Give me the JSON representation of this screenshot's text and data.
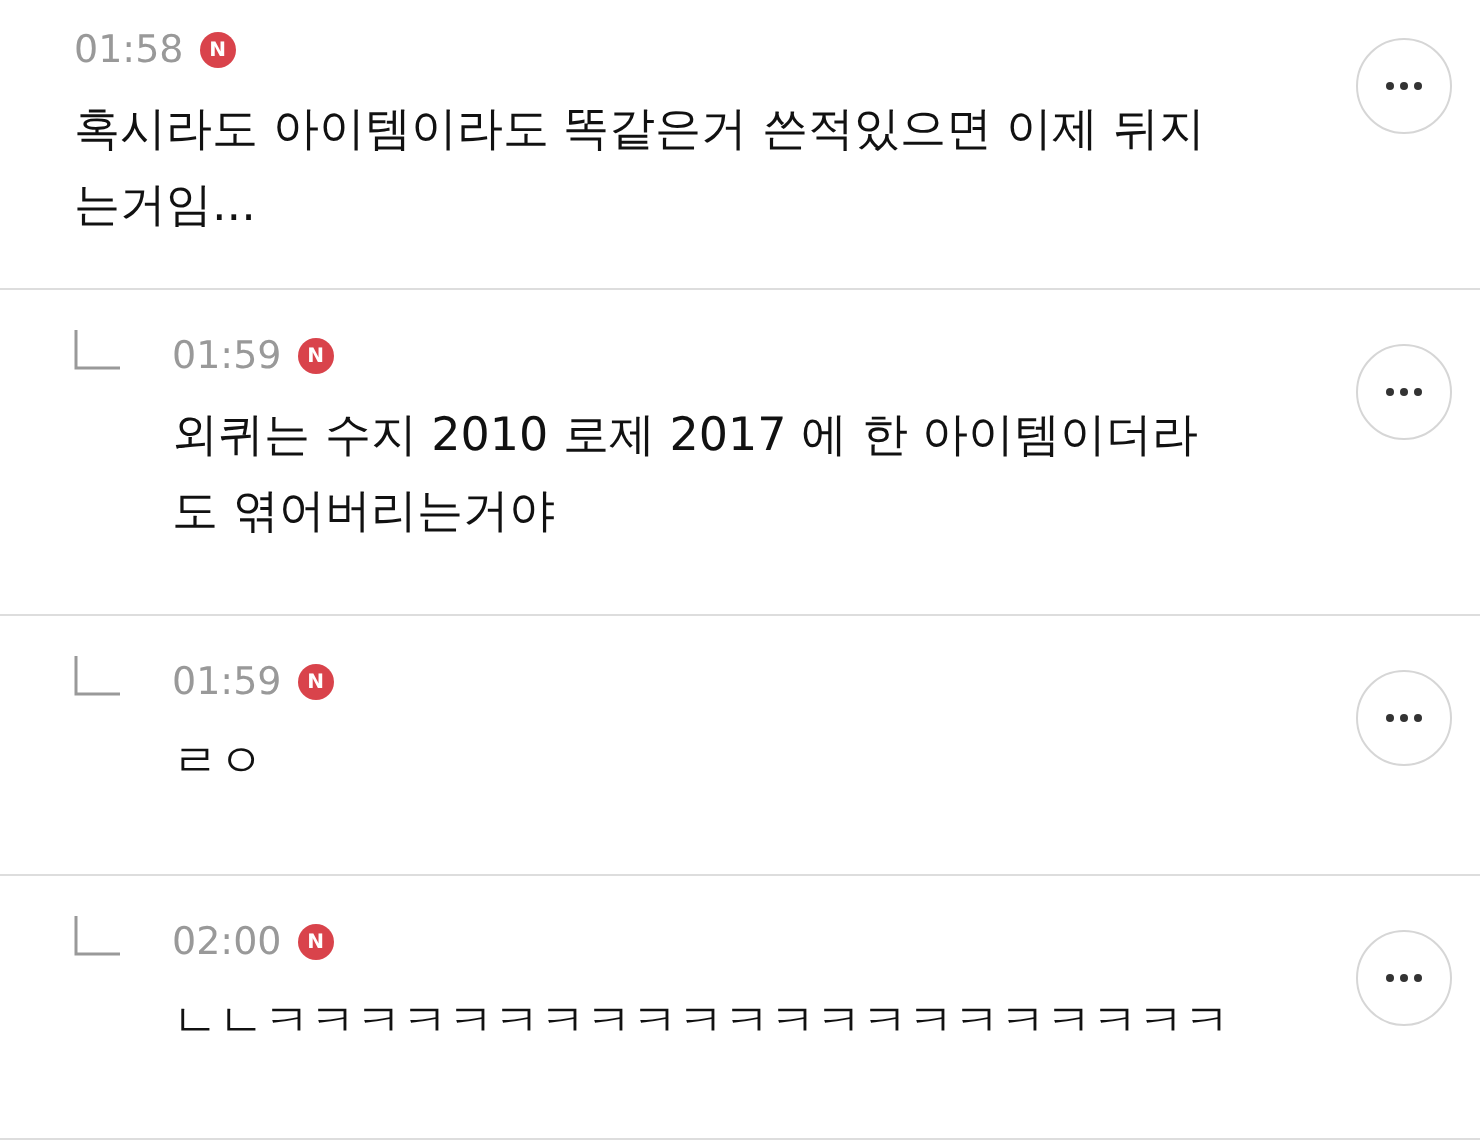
{
  "comments": [
    {
      "kind": "comment",
      "time": "01:58",
      "badge": "N",
      "lines": [
        "혹시라도 아이템이라도 똑같은거 쓴적있으면 이제 뒤지",
        "는거임..."
      ]
    },
    {
      "kind": "reply",
      "time": "01:59",
      "badge": "N",
      "lines": [
        "외퀴는 수지 2010 로제 2017 에 한 아이템이더라",
        "도 엮어버리는거야"
      ]
    },
    {
      "kind": "reply",
      "time": "01:59",
      "badge": "N",
      "lines": [
        "ㄹㅇ"
      ]
    },
    {
      "kind": "reply",
      "time": "02:00",
      "badge": "N",
      "lines": [
        "ㄴㄴㅋㅋㅋㅋㅋㅋㅋㅋㅋㅋㅋㅋㅋㅋㅋㅋㅋㅋㅋㅋㅋ"
      ]
    }
  ]
}
